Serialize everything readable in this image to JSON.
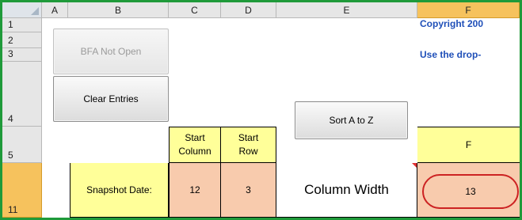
{
  "columns": [
    "A",
    "B",
    "C",
    "D",
    "E",
    "F"
  ],
  "rows": [
    "1",
    "2",
    "3",
    "4",
    "5",
    "11"
  ],
  "buttons": {
    "bfa_not_open": "BFA Not Open",
    "clear_entries": "Clear Entries",
    "sort_a_to_z": "Sort A to Z"
  },
  "f_column_text": {
    "copyright": "Copyright 200",
    "use_dropdown": "Use the drop-"
  },
  "header_row5": {
    "start_column_line1": "Start",
    "start_column_line2": "Column",
    "start_row_line1": "Start",
    "start_row_line2": "Row",
    "f_label": "F"
  },
  "row11": {
    "snapshot_label": "Snapshot Date:",
    "start_column_value": "12",
    "start_row_value": "3",
    "column_width_label": "Column Width",
    "column_width_value": "13"
  },
  "colors": {
    "frame": "#1f9a3a",
    "selected_header": "#f6c25d",
    "yellow_cell": "#ffff99",
    "salmon_cell": "#f8cbad",
    "blue_text": "#1f4fb8",
    "oval_border": "#cc2222"
  }
}
